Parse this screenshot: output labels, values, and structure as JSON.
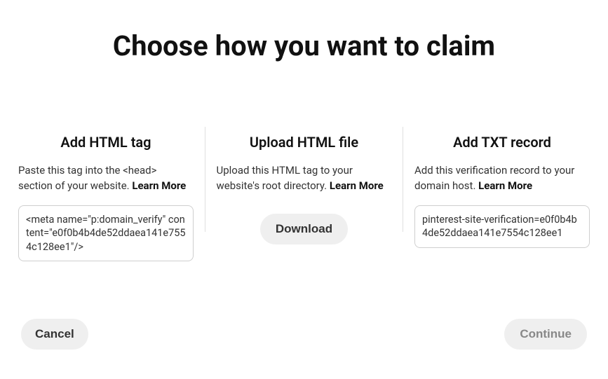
{
  "title": "Choose how you want to claim",
  "options": {
    "html_tag": {
      "title": "Add HTML tag",
      "desc": "Paste this tag into the <head> section of your website. ",
      "learn_more": "Learn More",
      "code": "<meta name=\"p:domain_verify\" content=\"e0f0b4b4de52ddaea141e7554c128ee1\"/>"
    },
    "upload_file": {
      "title": "Upload HTML file",
      "desc": "Upload this HTML tag to your website's root directory. ",
      "learn_more": "Learn More",
      "download_label": "Download"
    },
    "txt_record": {
      "title": "Add TXT record",
      "desc": "Add this verification record to your domain host. ",
      "learn_more": "Learn More",
      "code": "pinterest-site-verification=e0f0b4b4de52ddaea141e7554c128ee1"
    }
  },
  "footer": {
    "cancel_label": "Cancel",
    "continue_label": "Continue"
  }
}
